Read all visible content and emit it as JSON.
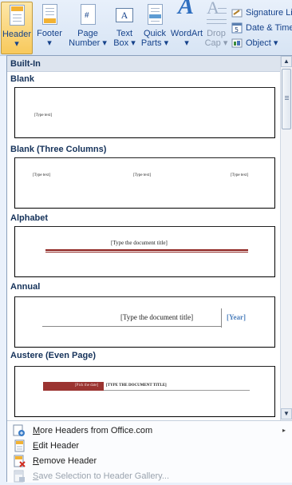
{
  "ribbon": {
    "header": {
      "label": "Header",
      "arrow": "▾"
    },
    "footer": {
      "label": "Footer",
      "arrow": "▾"
    },
    "page_number": {
      "label1": "Page",
      "label2": "Number ▾"
    },
    "text_box": {
      "label1": "Text",
      "label2": "Box ▾"
    },
    "quick_parts": {
      "label1": "Quick",
      "label2": "Parts ▾"
    },
    "wordart": {
      "label": "WordArt",
      "arrow": "▾"
    },
    "drop_cap": {
      "label1": "Drop",
      "label2": "Cap ▾"
    },
    "signature_line": {
      "label": "Signature Lin"
    },
    "date_time": {
      "label": "Date & Time"
    },
    "object": {
      "label": "Object ▾"
    }
  },
  "gallery": {
    "section": "Built-In",
    "items": [
      {
        "name": "Blank",
        "placeholders": [
          "[Type text]"
        ]
      },
      {
        "name": "Blank (Three Columns)",
        "placeholders": [
          "[Type text]",
          "[Type text]",
          "[Type text]"
        ]
      },
      {
        "name": "Alphabet",
        "placeholders": [
          "[Type the document title]"
        ]
      },
      {
        "name": "Annual",
        "placeholders": [
          "[Type the document title]",
          "[Year]"
        ]
      },
      {
        "name": "Austere (Even Page)",
        "placeholders": [
          "[Pick the date]",
          "[TYPE THE DOCUMENT TITLE]"
        ]
      }
    ]
  },
  "menu": {
    "more_headers": {
      "label_u": "M",
      "label_rest": "ore Headers from Office.com",
      "arrow": "▸"
    },
    "edit_header": {
      "label_u": "E",
      "label_rest": "dit Header"
    },
    "remove_header": {
      "label_u": "R",
      "label_rest": "emove Header"
    },
    "save_selection": {
      "label_u": "S",
      "label_rest": "ave Selection to Header Gallery..."
    }
  },
  "colors": {
    "austere_red": "#9b3431",
    "alphabet_line": "#8b1e1a",
    "annual_year": "#4f81bd",
    "ribbon_active": "#f8c95c"
  },
  "icons": [
    "header-icon",
    "footer-icon",
    "page-number-icon",
    "text-box-icon",
    "quick-parts-icon",
    "wordart-icon",
    "drop-cap-icon",
    "signature-line-icon",
    "date-time-icon",
    "object-icon"
  ]
}
